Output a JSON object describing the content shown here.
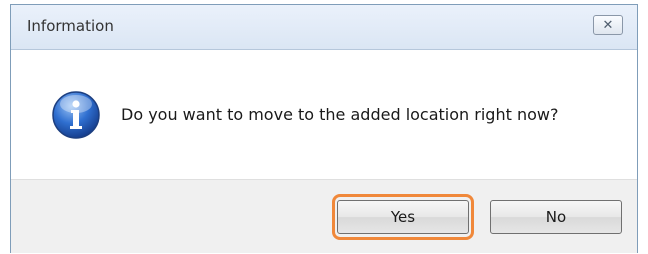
{
  "window": {
    "title": "Information",
    "close_icon": "close-icon"
  },
  "message": {
    "icon": "info-icon",
    "text": "Do you want to move to the added location right now?"
  },
  "buttons": {
    "yes_label": "Yes",
    "no_label": "No",
    "highlight_color": "#f0883a"
  }
}
